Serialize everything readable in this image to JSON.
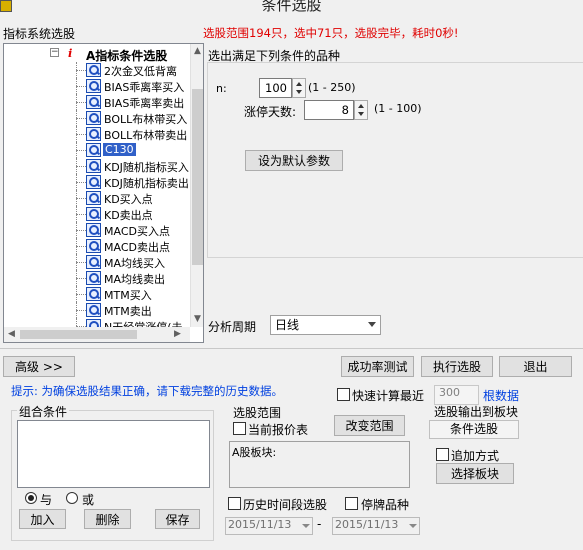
{
  "window": {
    "title": "条件选股"
  },
  "left": {
    "header": "指标系统选股"
  },
  "tree": {
    "root_label": "A指标条件选股",
    "root_marker": "i",
    "items": [
      {
        "label": "2次金叉低背离"
      },
      {
        "label": "BIAS乖离率买入"
      },
      {
        "label": "BIAS乖离率卖出"
      },
      {
        "label": "BOLL布林带买入"
      },
      {
        "label": "BOLL布林带卖出"
      },
      {
        "label": "C130",
        "selected": true
      },
      {
        "label": "KDJ随机指标买入"
      },
      {
        "label": "KDJ随机指标卖出"
      },
      {
        "label": "KD买入点"
      },
      {
        "label": "KD卖出点"
      },
      {
        "label": "MACD买入点"
      },
      {
        "label": "MACD卖出点"
      },
      {
        "label": "MA均线买入"
      },
      {
        "label": "MA均线卖出"
      },
      {
        "label": "MTM买入"
      },
      {
        "label": "MTM卖出"
      },
      {
        "label": "N天经常涨停(未"
      }
    ]
  },
  "status": {
    "message": "选股范围194只，选中71只，选股完毕，耗时0秒!"
  },
  "params": {
    "heading": "选出满足下列条件的品种",
    "n_label": "n:",
    "n_value": "100",
    "n_range": "(1 - 250)",
    "days_label": "涨停天数:",
    "days_value": "8",
    "days_range": "(1 - 100)",
    "default_button": "设为默认参数"
  },
  "period": {
    "label": "分析周期",
    "value": "日线"
  },
  "buttons": {
    "advanced": "高级 >>",
    "success_test": "成功率测试",
    "execute": "执行选股",
    "exit": "退出"
  },
  "hint": {
    "text": "提示: 为确保选股结果正确，请下载完整的历史数据。"
  },
  "fast_calc": {
    "label": "快速计算最近",
    "value": "300",
    "suffix": "根数据"
  },
  "combo": {
    "title": "组合条件",
    "and_label": "与",
    "or_label": "或",
    "add": "加入",
    "delete": "删除",
    "save": "保存"
  },
  "range": {
    "title": "选股范围",
    "current_quote": "当前报价表",
    "change_button": "改变范围",
    "content": "A股板块:"
  },
  "output": {
    "title": "选股输出到板块",
    "field": "条件选股",
    "append": "追加方式",
    "select_button": "选择板块"
  },
  "history": {
    "period_label": "历史时间段选股",
    "suspended_label": "停牌品种",
    "date_from": "2015/11/13",
    "date_to": "2015/11/13",
    "dash": "-"
  }
}
